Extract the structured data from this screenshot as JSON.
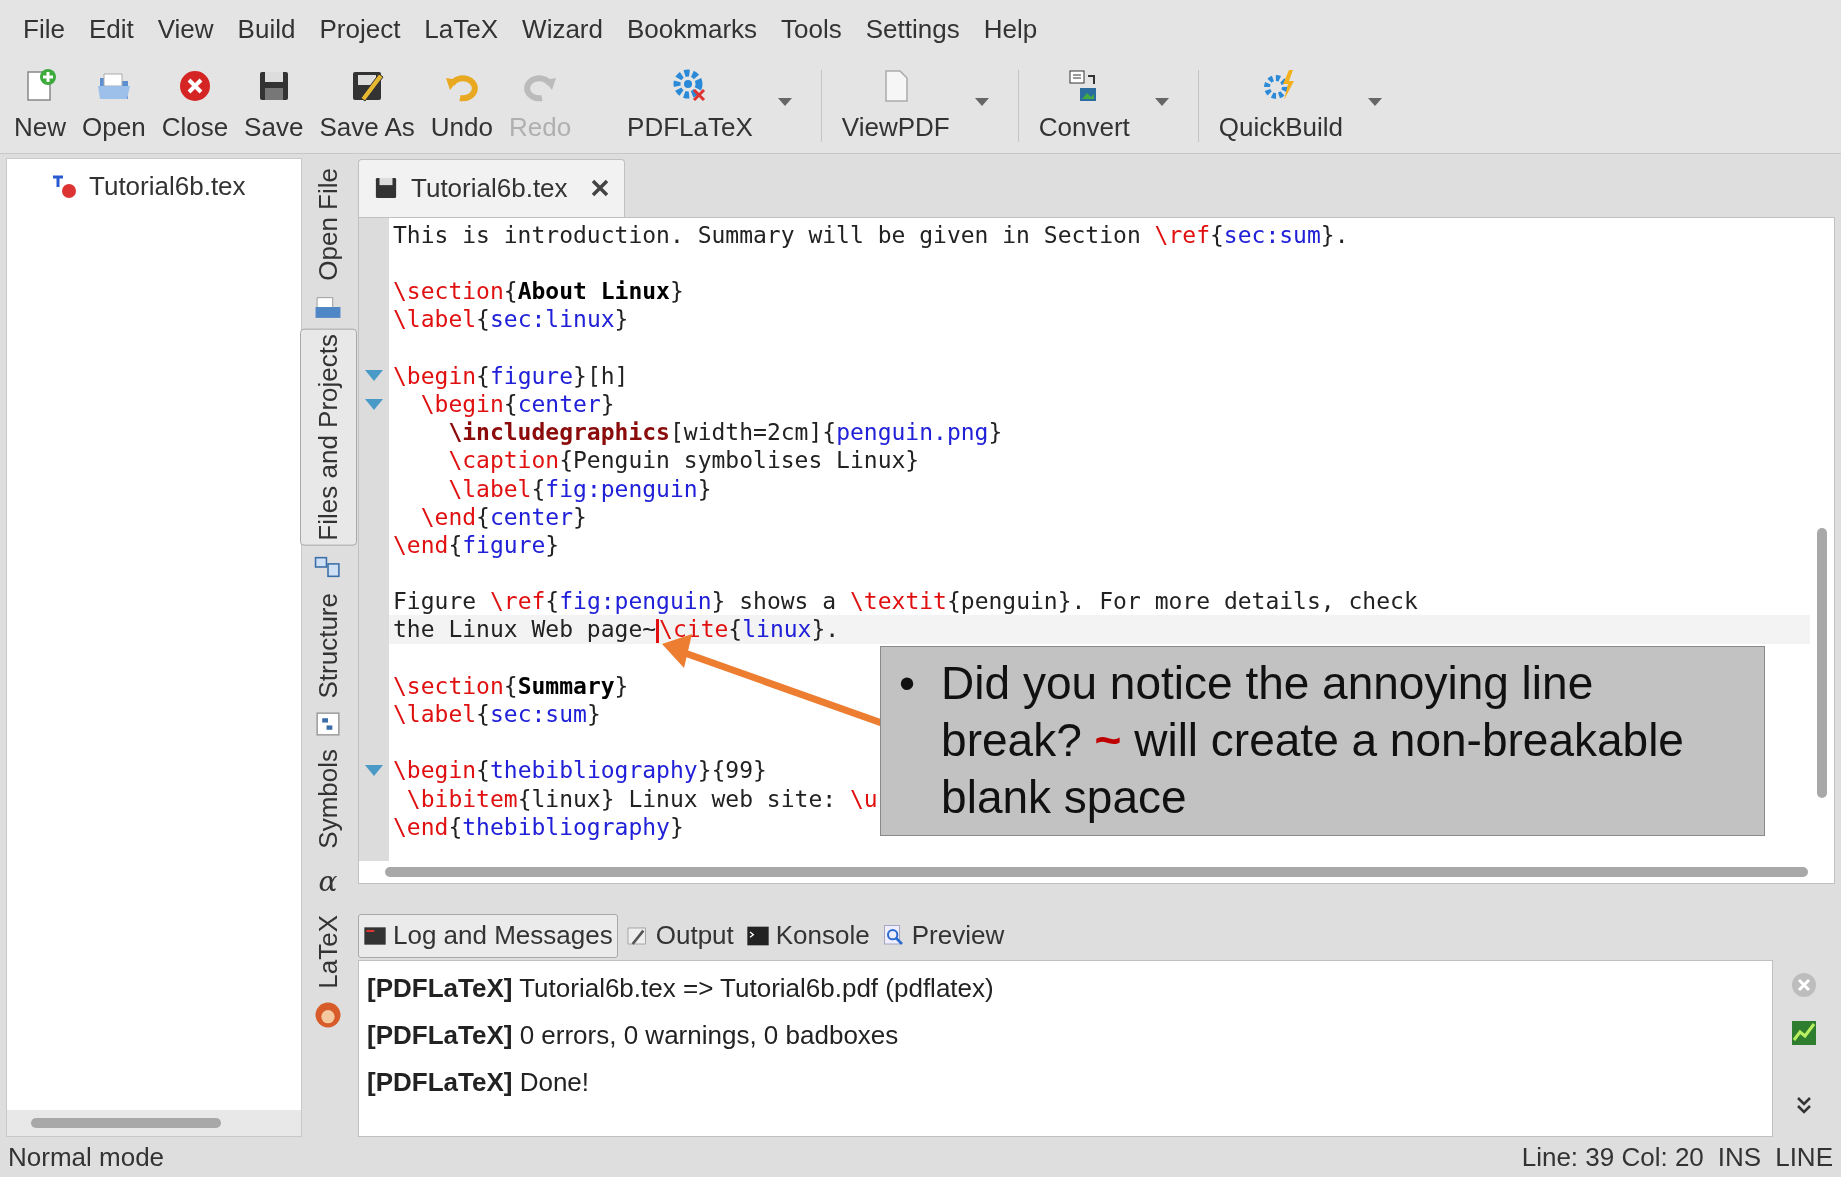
{
  "menu": [
    "File",
    "Edit",
    "View",
    "Build",
    "Project",
    "LaTeX",
    "Wizard",
    "Bookmarks",
    "Tools",
    "Settings",
    "Help"
  ],
  "toolbar": [
    {
      "label": "New",
      "disabled": false,
      "dropdown": false,
      "separator_before": false
    },
    {
      "label": "Open",
      "disabled": false,
      "dropdown": false,
      "separator_before": false
    },
    {
      "label": "Close",
      "disabled": false,
      "dropdown": false,
      "separator_before": false
    },
    {
      "label": "Save",
      "disabled": false,
      "dropdown": false,
      "separator_before": false
    },
    {
      "label": "Save As",
      "disabled": false,
      "dropdown": false,
      "separator_before": false
    },
    {
      "label": "Undo",
      "disabled": false,
      "dropdown": false,
      "separator_before": false
    },
    {
      "label": "Redo",
      "disabled": true,
      "dropdown": false,
      "separator_before": false
    },
    {
      "label": "PDFLaTeX",
      "disabled": false,
      "dropdown": true,
      "separator_before": false
    },
    {
      "label": "ViewPDF",
      "disabled": false,
      "dropdown": true,
      "separator_before": true
    },
    {
      "label": "Convert",
      "disabled": false,
      "dropdown": true,
      "separator_before": true
    },
    {
      "label": "QuickBuild",
      "disabled": false,
      "dropdown": true,
      "separator_before": true
    }
  ],
  "file_panel": {
    "items": [
      "Tutorial6b.tex"
    ]
  },
  "side_tabs": [
    {
      "label": "Open File",
      "selected": false
    },
    {
      "label": "Files and Projects",
      "selected": true
    },
    {
      "label": "Structure",
      "selected": false
    },
    {
      "label": "Symbols",
      "selected": false,
      "glyph": "α"
    },
    {
      "label": "LaTeX",
      "selected": false
    }
  ],
  "editor": {
    "tab": {
      "title": "Tutorial6b.tex"
    },
    "lines": [
      {
        "kind": "code",
        "fold": false,
        "current": false,
        "segments": [
          {
            "kind": "text",
            "text": "This is introduction. Summary will be given in Section "
          },
          {
            "kind": "cmd",
            "text": "\\ref"
          },
          {
            "kind": "text",
            "text": "{"
          },
          {
            "kind": "arg",
            "text": "sec:sum"
          },
          {
            "kind": "text",
            "text": "}."
          }
        ]
      },
      {
        "kind": "blank"
      },
      {
        "kind": "code",
        "fold": false,
        "current": false,
        "segments": [
          {
            "kind": "cmd",
            "text": "\\section"
          },
          {
            "kind": "text",
            "text": "{"
          },
          {
            "kind": "bold",
            "text": "About Linux"
          },
          {
            "kind": "text",
            "text": "}"
          }
        ]
      },
      {
        "kind": "code",
        "fold": false,
        "current": false,
        "segments": [
          {
            "kind": "cmd",
            "text": "\\label"
          },
          {
            "kind": "text",
            "text": "{"
          },
          {
            "kind": "arg",
            "text": "sec:linux"
          },
          {
            "kind": "text",
            "text": "}"
          }
        ]
      },
      {
        "kind": "blank"
      },
      {
        "kind": "code",
        "fold": true,
        "current": false,
        "segments": [
          {
            "kind": "cmd",
            "text": "\\begin"
          },
          {
            "kind": "text",
            "text": "{"
          },
          {
            "kind": "arg",
            "text": "figure"
          },
          {
            "kind": "text",
            "text": "}[h]"
          }
        ]
      },
      {
        "kind": "code",
        "fold": true,
        "current": false,
        "segments": [
          {
            "kind": "cmd",
            "text": "  \\begin"
          },
          {
            "kind": "text",
            "text": "{"
          },
          {
            "kind": "arg",
            "text": "center"
          },
          {
            "kind": "text",
            "text": "}"
          }
        ]
      },
      {
        "kind": "code",
        "fold": false,
        "current": false,
        "segments": [
          {
            "kind": "cmdbold",
            "text": "    \\includegraphics"
          },
          {
            "kind": "text",
            "text": "[width=2cm]{"
          },
          {
            "kind": "arg",
            "text": "penguin.png"
          },
          {
            "kind": "text",
            "text": "}"
          }
        ]
      },
      {
        "kind": "code",
        "fold": false,
        "current": false,
        "segments": [
          {
            "kind": "cmd",
            "text": "    \\caption"
          },
          {
            "kind": "text",
            "text": "{Penguin symbolises Linux}"
          }
        ]
      },
      {
        "kind": "code",
        "fold": false,
        "current": false,
        "segments": [
          {
            "kind": "cmd",
            "text": "    \\label"
          },
          {
            "kind": "text",
            "text": "{"
          },
          {
            "kind": "arg",
            "text": "fig:penguin"
          },
          {
            "kind": "text",
            "text": "}"
          }
        ]
      },
      {
        "kind": "code",
        "fold": false,
        "current": false,
        "segments": [
          {
            "kind": "cmd",
            "text": "  \\end"
          },
          {
            "kind": "text",
            "text": "{"
          },
          {
            "kind": "arg",
            "text": "center"
          },
          {
            "kind": "text",
            "text": "}"
          }
        ]
      },
      {
        "kind": "code",
        "fold": false,
        "current": false,
        "segments": [
          {
            "kind": "cmd",
            "text": "\\end"
          },
          {
            "kind": "text",
            "text": "{"
          },
          {
            "kind": "arg",
            "text": "figure"
          },
          {
            "kind": "text",
            "text": "}"
          }
        ]
      },
      {
        "kind": "blank"
      },
      {
        "kind": "code",
        "fold": false,
        "current": false,
        "segments": [
          {
            "kind": "text",
            "text": "Figure "
          },
          {
            "kind": "cmd",
            "text": "\\ref"
          },
          {
            "kind": "text",
            "text": "{"
          },
          {
            "kind": "arg",
            "text": "fig:penguin"
          },
          {
            "kind": "text",
            "text": "} shows a "
          },
          {
            "kind": "cmd",
            "text": "\\textit"
          },
          {
            "kind": "text",
            "text": "{penguin}. For more details, check"
          }
        ]
      },
      {
        "kind": "code",
        "fold": false,
        "current": true,
        "segments": [
          {
            "kind": "text",
            "text": "the Linux Web page~"
          },
          {
            "kind": "cmd",
            "text": "\\cite",
            "cursor": true
          },
          {
            "kind": "text",
            "text": "{"
          },
          {
            "kind": "arg",
            "text": "linux"
          },
          {
            "kind": "text",
            "text": "}."
          }
        ]
      },
      {
        "kind": "blank"
      },
      {
        "kind": "code",
        "fold": false,
        "current": false,
        "segments": [
          {
            "kind": "cmd",
            "text": "\\section"
          },
          {
            "kind": "text",
            "text": "{"
          },
          {
            "kind": "bold",
            "text": "Summary"
          },
          {
            "kind": "text",
            "text": "}"
          }
        ]
      },
      {
        "kind": "code",
        "fold": false,
        "current": false,
        "segments": [
          {
            "kind": "cmd",
            "text": "\\label"
          },
          {
            "kind": "text",
            "text": "{"
          },
          {
            "kind": "arg",
            "text": "sec:sum"
          },
          {
            "kind": "text",
            "text": "}"
          }
        ]
      },
      {
        "kind": "blank"
      },
      {
        "kind": "code",
        "fold": true,
        "current": false,
        "segments": [
          {
            "kind": "cmd",
            "text": "\\begin"
          },
          {
            "kind": "text",
            "text": "{"
          },
          {
            "kind": "arg",
            "text": "thebibliography"
          },
          {
            "kind": "text",
            "text": "}{99}"
          }
        ]
      },
      {
        "kind": "code",
        "fold": false,
        "current": false,
        "segments": [
          {
            "kind": "cmd",
            "text": " \\bibitem"
          },
          {
            "kind": "text",
            "text": "{linux} Linux web site: "
          },
          {
            "kind": "cmd",
            "text": "\\u"
          }
        ]
      },
      {
        "kind": "code",
        "fold": false,
        "current": false,
        "segments": [
          {
            "kind": "cmd",
            "text": "\\end"
          },
          {
            "kind": "text",
            "text": "{"
          },
          {
            "kind": "arg",
            "text": "thebibliography"
          },
          {
            "kind": "text",
            "text": "}"
          }
        ]
      }
    ]
  },
  "annotation": {
    "bullet": "•",
    "parts": [
      {
        "text": "Did you notice the annoying line break? ",
        "accent": false
      },
      {
        "text": "~",
        "accent": true
      },
      {
        "text": " will create a non-breakable blank space",
        "accent": false
      }
    ]
  },
  "bottom_tabs": [
    {
      "label": "Log and Messages",
      "selected": true
    },
    {
      "label": "Output",
      "selected": false
    },
    {
      "label": "Konsole",
      "selected": false
    },
    {
      "label": "Preview",
      "selected": false
    }
  ],
  "log": [
    "**[PDFLaTeX]** Tutorial6b.tex => Tutorial6b.pdf (pdflatex)",
    "**[PDFLaTeX]** 0 errors, 0 warnings, 0 badboxes",
    "**[PDFLaTeX]** Done!"
  ],
  "status_bar": {
    "mode": "Normal mode",
    "position": "Line: 39 Col: 20",
    "insert": "INS",
    "selection": "LINE"
  }
}
